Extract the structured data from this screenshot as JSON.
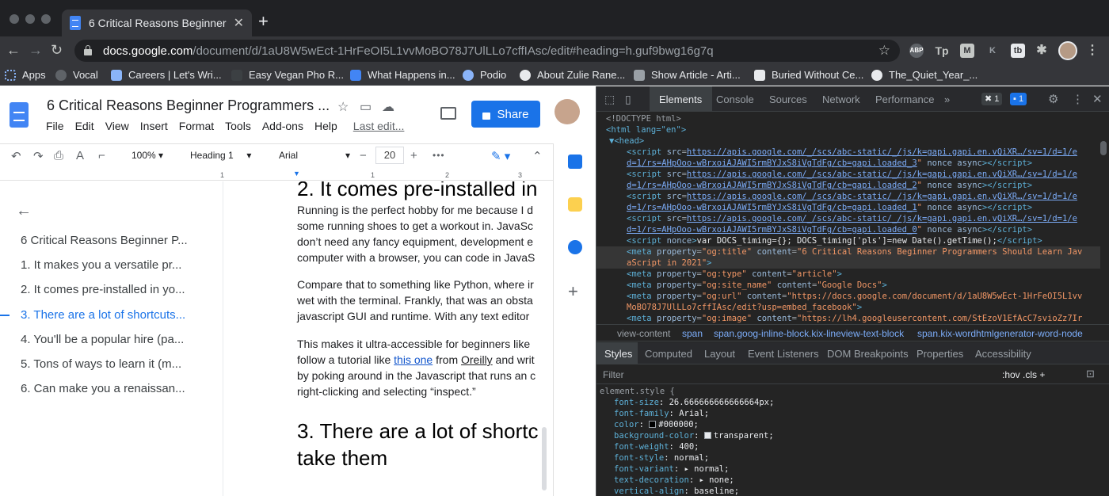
{
  "browser": {
    "tab_title": "6 Critical Reasons Beginner Pr",
    "url_domain": "docs.google.com",
    "url_path": "/document/d/1aU8W5wEct-1HrFeOI5L1vvMoBO78J7UlLLo7cffIAsc/edit#heading=h.guf9bwg16g7q",
    "extensions": [
      "ABP",
      "Tp",
      "M",
      "K",
      "tb"
    ],
    "bookmarks": [
      "Apps",
      "Vocal",
      "Careers | Let's Wri...",
      "Easy Vegan Pho R...",
      "What Happens in...",
      "Podio",
      "About Zulie Rane...",
      "Show Article - Arti...",
      "Buried Without Ce...",
      "The_Quiet_Year_..."
    ]
  },
  "docs": {
    "title": "6 Critical Reasons Beginner Programmers ...",
    "menus": [
      "File",
      "Edit",
      "View",
      "Insert",
      "Format",
      "Tools",
      "Add-ons",
      "Help"
    ],
    "last_edit": "Last edit...",
    "share_label": "Share",
    "toolbar": {
      "zoom": "100%",
      "style": "Heading 1",
      "font": "Arial",
      "font_size": "20",
      "minus": "−",
      "plus": "+",
      "more": "•••"
    },
    "ruler": [
      "1",
      "1",
      "2",
      "3"
    ],
    "outline": [
      "6 Critical Reasons Beginner P...",
      "1. It makes you a versatile pr...",
      "2. It comes pre-installed in yo...",
      "3. There are a lot of shortcuts...",
      "4. You'll be a popular hire (pa...",
      "5. Tons of ways to learn it (m...",
      "6. Can make you a renaissan..."
    ],
    "outline_active_index": 3,
    "body": {
      "heading2": "2. It comes pre-installed in",
      "p1": [
        "Running is the perfect hobby for me because I d",
        "some running shoes to get a workout in. JavaSc",
        "don’t need any fancy equipment, development e",
        "computer with a browser, you can code in JavaS"
      ],
      "p2": [
        "Compare that to something like Python, where ir",
        "wet with the terminal. Frankly, that was an obsta",
        "javascript GUI and runtime. With any text editor"
      ],
      "p3_line1": "This makes it ultra-accessible for beginners like",
      "p3_line2_pre": "follow a tutorial like ",
      "p3_link": "this one",
      "p3_line2_mid": " from ",
      "p3_link2": "Oreilly",
      "p3_line2_post": " and writ",
      "p3_line3": "by poking around in the Javascript that runs an c",
      "p3_line4": "right-clicking and selecting “inspect.”",
      "heading3_line1": "3. There are a lot of shortc",
      "heading3_line2": "take them"
    }
  },
  "devtools": {
    "tabs": [
      "Elements",
      "Console",
      "Sources",
      "Network",
      "Performance",
      "»"
    ],
    "active_tab": "Elements",
    "badges": [
      "1",
      "1"
    ],
    "dom_lines": [
      "<!DOCTYPE html>",
      "<html lang=\"en\">",
      "▼<head>"
    ],
    "script_src": [
      "https://apis.google.com/_/scs/abc-static/_/js/k=gapi.gapi.en.vQiXR…/sv=1/d=1/e",
      "d=1/rs=AHpOoo-wBrxoiAJAWI5rmBYJxS8iVgTdFg/cb=gapi.loaded_3",
      "https://apis.google.com/_/scs/abc-static/_/js/k=gapi.gapi.en.vQiXR…/sv=1/d=1/e",
      "d=1/rs=AHpOoo-wBrxoiAJAWI5rmBYJxS8iVgTdFg/cb=gapi.loaded_2",
      "https://apis.google.com/_/scs/abc-static/_/js/k=gapi.gapi.en.vQiXR…/sv=1/d=1/e",
      "d=1/rs=AHpOoo-wBrxoiAJAWI5rmBYJxS8iVgTdFg/cb=gapi.loaded_1",
      "https://apis.google.com/_/scs/abc-static/_/js/k=gapi.gapi.en.vQiXR…/sv=1/d=1/e",
      "d=1/rs=AHpOoo-wBrxoiAJAWI5rmBYJxS8iVgTdFg/cb=gapi.loaded_0"
    ],
    "nonce_script": "var DOCS_timing={}; DOCS_timing['pls']=new Date().getTime();",
    "og_title_1": "6 Critical Reasons Beginner Programmers Should Learn Jav",
    "og_title_2": "aScript in 2021",
    "og_type": "article",
    "og_site_name": "Google Docs",
    "og_url_1": "https://docs.google.com/document/d/1aU8W5wEct-1HrFeOI5L1vv",
    "og_url_2": "MoBO78J7UlLLo7cffIAsc/edit?usp=embed_facebook",
    "og_image": "https://lh4.googleusercontent.com/StEzoV1EfAcC7svioZz7Ir",
    "breadcrumbs": [
      "view-content",
      "span",
      "span.goog-inline-block.kix-lineview-text-block",
      "span.kix-wordhtmlgenerator-word-node"
    ],
    "style_tabs": [
      "Styles",
      "Computed",
      "Layout",
      "Event Listeners",
      "DOM Breakpoints",
      "Properties",
      "Accessibility"
    ],
    "filter_placeholder": "Filter",
    "filter_tools": ":hov  .cls  +",
    "element_style": "element.style {",
    "props": [
      {
        "name": "font-size",
        "value": "26.666666666666664px;"
      },
      {
        "name": "font-family",
        "value": "Arial;"
      },
      {
        "name": "color",
        "value": "#000000;"
      },
      {
        "name": "background-color",
        "value": "transparent;"
      },
      {
        "name": "font-weight",
        "value": "400;"
      },
      {
        "name": "font-style",
        "value": "normal;"
      },
      {
        "name": "font-variant",
        "value": "normal;"
      },
      {
        "name": "text-decoration",
        "value": "none;"
      },
      {
        "name": "vertical-align",
        "value": "baseline;"
      }
    ]
  }
}
